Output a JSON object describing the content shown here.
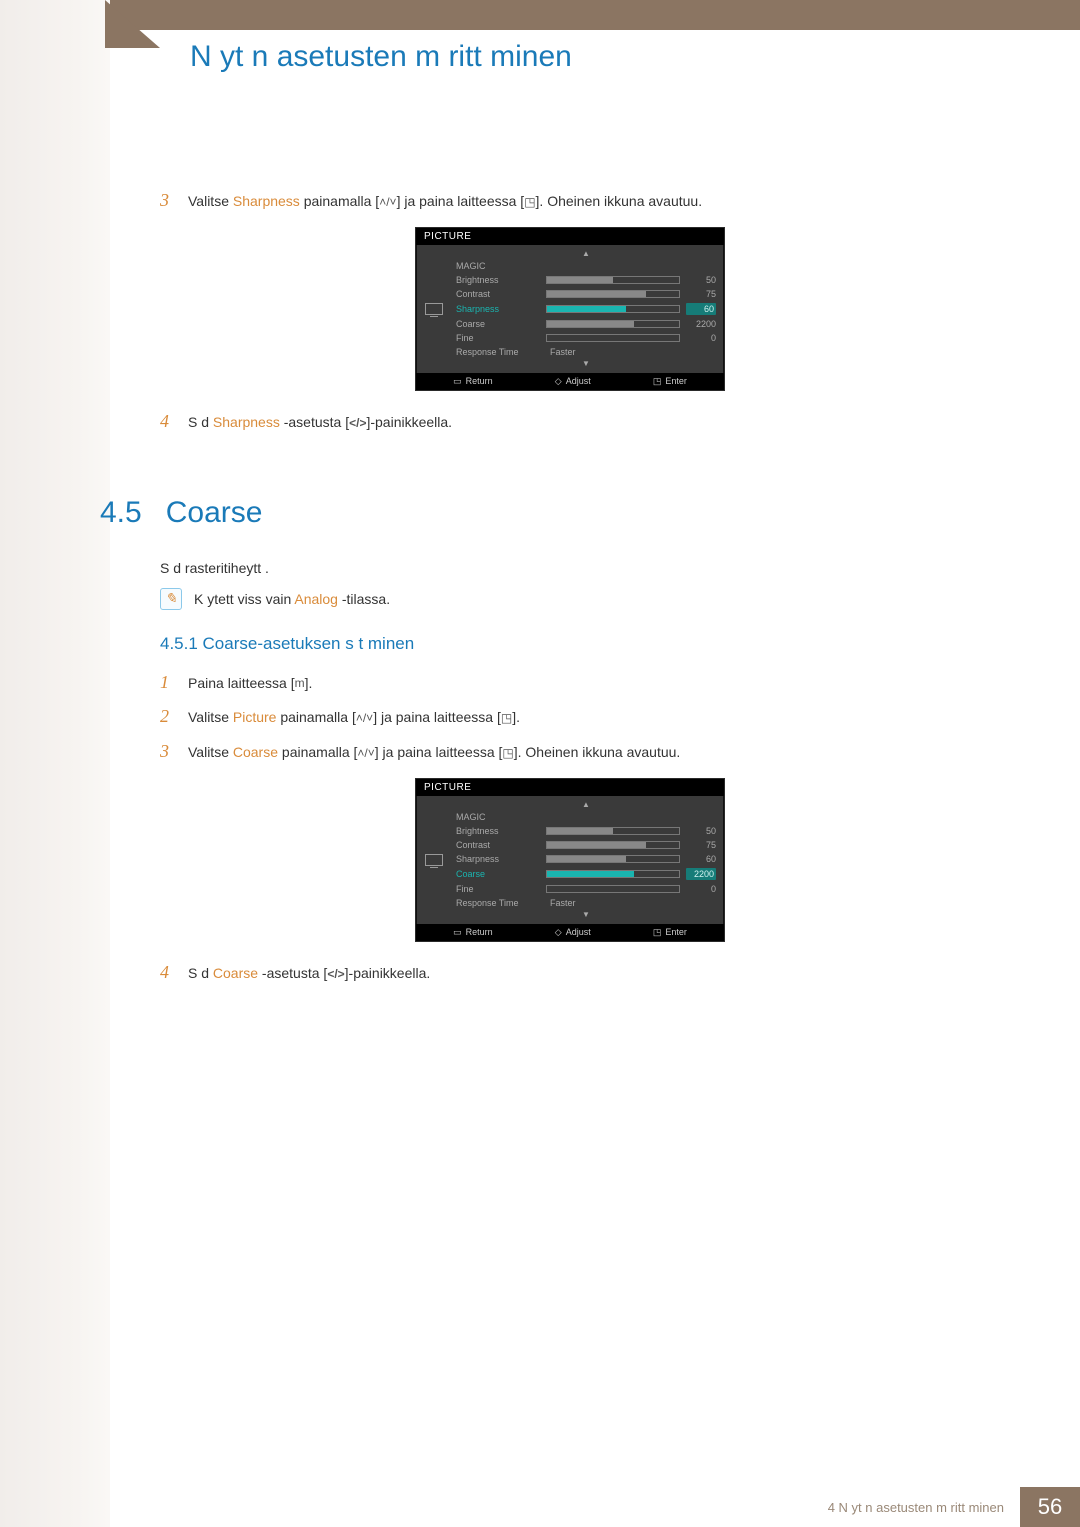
{
  "header": {
    "title": "N yt n asetusten m ritt minen"
  },
  "step3a": {
    "num": "3",
    "pre": "Valitse ",
    "hl": "Sharpness",
    "mid": " painamalla [",
    "mid2": "] ja paina laitteessa [",
    "post": "]. Oheinen ikkuna avautuu."
  },
  "osd1": {
    "title": "PICTURE",
    "rows": [
      {
        "label": "MAGIC",
        "type": "blank"
      },
      {
        "label": "Brightness",
        "type": "bar",
        "value": "50",
        "fill": 50
      },
      {
        "label": "Contrast",
        "type": "bar",
        "value": "75",
        "fill": 75
      },
      {
        "label": "Sharpness",
        "type": "bar",
        "value": "60",
        "fill": 60,
        "selected": true
      },
      {
        "label": "Coarse",
        "type": "bar",
        "value": "2200",
        "fill": 66
      },
      {
        "label": "Fine",
        "type": "bar",
        "value": "0",
        "fill": 0
      },
      {
        "label": "Response Time",
        "type": "text",
        "value": "Faster"
      }
    ],
    "footer": {
      "return": "Return",
      "adjust": "Adjust",
      "enter": "Enter"
    }
  },
  "step4a": {
    "num": "4",
    "pre": "S d ",
    "hl": "Sharpness",
    "post": " -asetusta [",
    "tail": "]-painikkeella."
  },
  "section45": {
    "num": "4.5",
    "name": "Coarse",
    "intro": "S d rasteritiheytt .",
    "note_pre": "K ytett viss vain ",
    "note_hl": "Analog",
    "note_post": " -tilassa."
  },
  "sub451": {
    "title": "4.5.1 Coarse-asetuksen s t minen"
  },
  "step1b": {
    "num": "1",
    "text": "Paina laitteessa [",
    "tail": "]."
  },
  "step2b": {
    "num": "2",
    "pre": "Valitse ",
    "hl": "Picture",
    "mid": " painamalla [",
    "mid2": "] ja paina laitteessa [",
    "post": "]."
  },
  "step3b": {
    "num": "3",
    "pre": "Valitse ",
    "hl": "Coarse",
    "mid": " painamalla [",
    "mid2": "] ja paina laitteessa [",
    "post": "]. Oheinen ikkuna avautuu."
  },
  "osd2": {
    "title": "PICTURE",
    "rows": [
      {
        "label": "MAGIC",
        "type": "blank"
      },
      {
        "label": "Brightness",
        "type": "bar",
        "value": "50",
        "fill": 50
      },
      {
        "label": "Contrast",
        "type": "bar",
        "value": "75",
        "fill": 75
      },
      {
        "label": "Sharpness",
        "type": "bar",
        "value": "60",
        "fill": 60
      },
      {
        "label": "Coarse",
        "type": "bar",
        "value": "2200",
        "fill": 66,
        "selected": true
      },
      {
        "label": "Fine",
        "type": "bar",
        "value": "0",
        "fill": 0
      },
      {
        "label": "Response Time",
        "type": "text",
        "value": "Faster"
      }
    ],
    "footer": {
      "return": "Return",
      "adjust": "Adjust",
      "enter": "Enter"
    }
  },
  "step4b": {
    "num": "4",
    "pre": "S d ",
    "hl": "Coarse",
    "post": " -asetusta [",
    "tail": "]-painikkeella."
  },
  "footer": {
    "text": "4 N yt n asetusten m ritt minen",
    "page": "56"
  },
  "glyphs": {
    "updown": "˄/˅",
    "enter": "◳",
    "menu": "m",
    "lr": "</>",
    "adjust": "◇",
    "return": "▭"
  }
}
